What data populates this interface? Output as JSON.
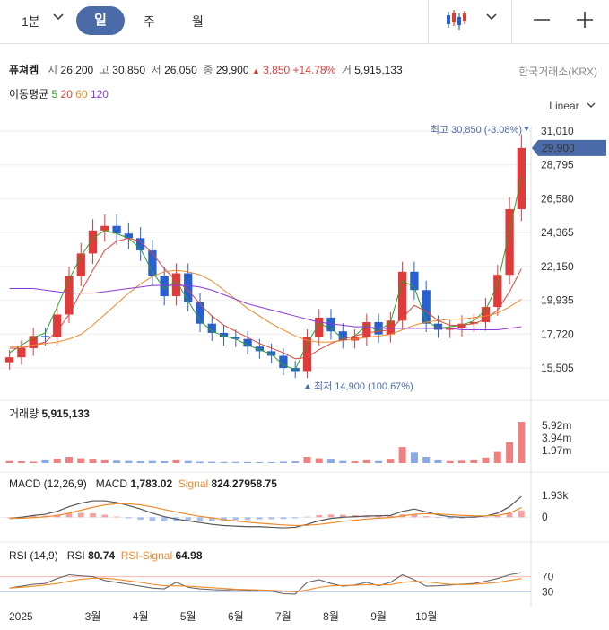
{
  "toolbar": {
    "interval": "1분",
    "tabs": [
      "일",
      "주",
      "월"
    ],
    "active_tab": "일"
  },
  "quote": {
    "name": "퓨쳐켐",
    "open_label": "시",
    "open": "26,200",
    "high_label": "고",
    "high": "30,850",
    "low_label": "저",
    "low": "26,050",
    "close_label": "종",
    "close": "29,900",
    "change": "3,850",
    "change_pct": "+14.78%",
    "volume_label": "거",
    "volume": "5,915,133",
    "exchange": "한국거래소(KRX)"
  },
  "ma": {
    "label": "이동평균",
    "periods": [
      "5",
      "20",
      "60",
      "120"
    ],
    "colors": [
      "#2aa12a",
      "#e0453a",
      "#f08a2b",
      "#8a3ad6"
    ]
  },
  "scale_mode": "Linear",
  "colors": {
    "up": "#e03a3a",
    "down": "#2a5fcf",
    "accent": "#4a6aa8",
    "macd": "#555555",
    "signal": "#f08a2b"
  },
  "chart_data": [
    {
      "type": "candlestick",
      "title": "",
      "x_ticks": [
        "2025",
        "3월",
        "4월",
        "5월",
        "6월",
        "7월",
        "8월",
        "9월",
        "10월"
      ],
      "y_ticks": [
        "31,010",
        "28,795",
        "26,580",
        "24,365",
        "22,150",
        "19,935",
        "17,720",
        "15,505"
      ],
      "ylim": [
        15505,
        31010
      ],
      "last_price_label": "29,900",
      "high_marker": "최고 30,850 (-3.08%)",
      "low_marker": "최저 14,900 (100.67%)",
      "close_points": [
        {
          "x": "2025-01",
          "y": 16200
        },
        {
          "x": "2025-01",
          "y": 16800
        },
        {
          "x": "2025-01",
          "y": 17600
        },
        {
          "x": "2025-01",
          "y": 17500
        },
        {
          "x": "2025-02",
          "y": 19000
        },
        {
          "x": "2025-02",
          "y": 21500
        },
        {
          "x": "2025-02",
          "y": 23000
        },
        {
          "x": "2025-02",
          "y": 24500
        },
        {
          "x": "2025-03",
          "y": 24800
        },
        {
          "x": "2025-03",
          "y": 24300
        },
        {
          "x": "2025-03",
          "y": 24000
        },
        {
          "x": "2025-03",
          "y": 23200
        },
        {
          "x": "2025-04",
          "y": 21500
        },
        {
          "x": "2025-04",
          "y": 20200
        },
        {
          "x": "2025-04",
          "y": 21700
        },
        {
          "x": "2025-04",
          "y": 19800
        },
        {
          "x": "2025-05",
          "y": 18400
        },
        {
          "x": "2025-05",
          "y": 17800
        },
        {
          "x": "2025-05",
          "y": 17500
        },
        {
          "x": "2025-05",
          "y": 17400
        },
        {
          "x": "2025-06",
          "y": 16900
        },
        {
          "x": "2025-06",
          "y": 16600
        },
        {
          "x": "2025-06",
          "y": 16300
        },
        {
          "x": "2025-06",
          "y": 15500
        },
        {
          "x": "2025-07",
          "y": 15300
        },
        {
          "x": "2025-07",
          "y": 17500
        },
        {
          "x": "2025-07",
          "y": 18800
        },
        {
          "x": "2025-07",
          "y": 17900
        },
        {
          "x": "2025-08",
          "y": 17300
        },
        {
          "x": "2025-08",
          "y": 17500
        },
        {
          "x": "2025-08",
          "y": 18500
        },
        {
          "x": "2025-08",
          "y": 17700
        },
        {
          "x": "2025-09",
          "y": 18600
        },
        {
          "x": "2025-09",
          "y": 21800
        },
        {
          "x": "2025-09",
          "y": 20600
        },
        {
          "x": "2025-09",
          "y": 18400
        },
        {
          "x": "2025-10",
          "y": 18000
        },
        {
          "x": "2025-10",
          "y": 18100
        },
        {
          "x": "2025-10",
          "y": 18400
        },
        {
          "x": "2025-10",
          "y": 18500
        },
        {
          "x": "2025-11",
          "y": 19500
        },
        {
          "x": "2025-11",
          "y": 21600
        },
        {
          "x": "2025-11",
          "y": 25900
        },
        {
          "x": "2025-11",
          "y": 29900
        }
      ],
      "ma_lines": [
        {
          "name": "5",
          "values": [
            16500,
            17000,
            17500,
            17800,
            19500,
            21300,
            22800,
            24000,
            24500,
            24300,
            24000,
            23300,
            21800,
            20700,
            21200,
            19900,
            18600,
            17900,
            17600,
            17400,
            17000,
            16700,
            16400,
            15700,
            15400,
            17100,
            18400,
            18100,
            17400,
            17600,
            18300,
            17900,
            18500,
            21200,
            20800,
            18600,
            18100,
            18200,
            18300,
            18600,
            19300,
            21000,
            24500,
            28000
          ]
        },
        {
          "name": "20",
          "values": [
            16800,
            16800,
            17000,
            17200,
            17900,
            19000,
            20500,
            21900,
            23200,
            23800,
            24000,
            23800,
            23000,
            22000,
            21200,
            20600,
            19700,
            18900,
            18300,
            17900,
            17500,
            17100,
            16800,
            16500,
            16100,
            16200,
            16700,
            17100,
            17400,
            17600,
            17800,
            17900,
            18000,
            18800,
            19600,
            19200,
            18600,
            18300,
            18300,
            18400,
            18700,
            19300,
            20500,
            22000
          ]
        },
        {
          "name": "60",
          "values": [
            16900,
            16900,
            17000,
            17100,
            17200,
            17400,
            17700,
            18300,
            19000,
            19700,
            20400,
            21000,
            21500,
            21800,
            21900,
            21800,
            21600,
            21200,
            20600,
            20000,
            19400,
            18900,
            18400,
            18000,
            17600,
            17300,
            17200,
            17200,
            17300,
            17400,
            17500,
            17600,
            17700,
            18000,
            18300,
            18500,
            18600,
            18700,
            18700,
            18800,
            18900,
            19100,
            19500,
            20000
          ]
        },
        {
          "name": "120",
          "values": [
            20700,
            20700,
            20700,
            20600,
            20500,
            20400,
            20400,
            20400,
            20500,
            20600,
            20700,
            20800,
            20900,
            20900,
            20900,
            20900,
            20800,
            20600,
            20300,
            20000,
            19700,
            19500,
            19300,
            19100,
            18900,
            18700,
            18500,
            18400,
            18300,
            18200,
            18200,
            18100,
            18100,
            18100,
            18100,
            18100,
            18100,
            18100,
            18000,
            18000,
            18000,
            18000,
            18100,
            18200
          ]
        }
      ]
    },
    {
      "type": "bar",
      "title": "거래량",
      "current": "5,915,133",
      "y_ticks": [
        "5.92m",
        "3.94m",
        "1.97m"
      ],
      "ylim": [
        0,
        5920000
      ],
      "values": [
        300000,
        250000,
        200000,
        400000,
        600000,
        900000,
        700000,
        500000,
        400000,
        350000,
        300000,
        250000,
        300000,
        250000,
        400000,
        300000,
        200000,
        180000,
        150000,
        160000,
        150000,
        140000,
        130000,
        200000,
        250000,
        900000,
        700000,
        500000,
        300000,
        250000,
        400000,
        300000,
        500000,
        2300000,
        1500000,
        900000,
        400000,
        300000,
        350000,
        400000,
        800000,
        1600000,
        3000000,
        5915133
      ]
    },
    {
      "type": "line",
      "title": "MACD (12,26,9)",
      "macd_label": "MACD",
      "macd_value": "1,783.02",
      "signal_label": "Signal",
      "signal_value": "824.27958.75",
      "y_ticks": [
        "1.93k",
        "0"
      ],
      "ylim": [
        -1200,
        2400
      ],
      "series": [
        {
          "name": "MACD",
          "values": [
            -100,
            0,
            150,
            250,
            500,
            900,
            1200,
            1400,
            1400,
            1250,
            1000,
            700,
            350,
            50,
            -150,
            -300,
            -450,
            -600,
            -700,
            -750,
            -800,
            -800,
            -850,
            -900,
            -850,
            -600,
            -300,
            -100,
            0,
            50,
            100,
            120,
            150,
            500,
            700,
            450,
            200,
            50,
            0,
            20,
            100,
            350,
            900,
            1783
          ]
        },
        {
          "name": "Signal",
          "values": [
            -100,
            -80,
            -30,
            40,
            150,
            350,
            600,
            850,
            1050,
            1150,
            1150,
            1050,
            880,
            650,
            450,
            250,
            80,
            -60,
            -200,
            -320,
            -420,
            -500,
            -580,
            -650,
            -700,
            -680,
            -600,
            -480,
            -350,
            -250,
            -150,
            -80,
            -20,
            100,
            250,
            300,
            280,
            220,
            160,
            120,
            110,
            160,
            350,
            824
          ]
        }
      ]
    },
    {
      "type": "line",
      "title": "RSI (14,9)",
      "rsi_label": "RSI",
      "rsi_value": "80.74",
      "rsi_signal_label": "RSI-Signal",
      "rsi_signal_value": "64.98",
      "y_ticks": [
        "70",
        "30"
      ],
      "ylim": [
        0,
        100
      ],
      "series": [
        {
          "name": "RSI",
          "values": [
            40,
            45,
            50,
            52,
            65,
            75,
            72,
            70,
            60,
            55,
            50,
            45,
            40,
            38,
            55,
            42,
            38,
            36,
            35,
            36,
            34,
            33,
            32,
            25,
            24,
            55,
            62,
            52,
            45,
            48,
            55,
            46,
            55,
            75,
            62,
            45,
            46,
            48,
            50,
            52,
            58,
            65,
            75,
            80.74
          ]
        },
        {
          "name": "RSI-Signal",
          "values": [
            40,
            42,
            45,
            48,
            52,
            58,
            63,
            66,
            66,
            63,
            59,
            55,
            50,
            46,
            46,
            45,
            43,
            41,
            39,
            37,
            36,
            35,
            34,
            32,
            30,
            35,
            42,
            46,
            47,
            47,
            49,
            48,
            49,
            55,
            58,
            56,
            53,
            50,
            49,
            50,
            52,
            55,
            60,
            64.98
          ]
        }
      ]
    }
  ]
}
